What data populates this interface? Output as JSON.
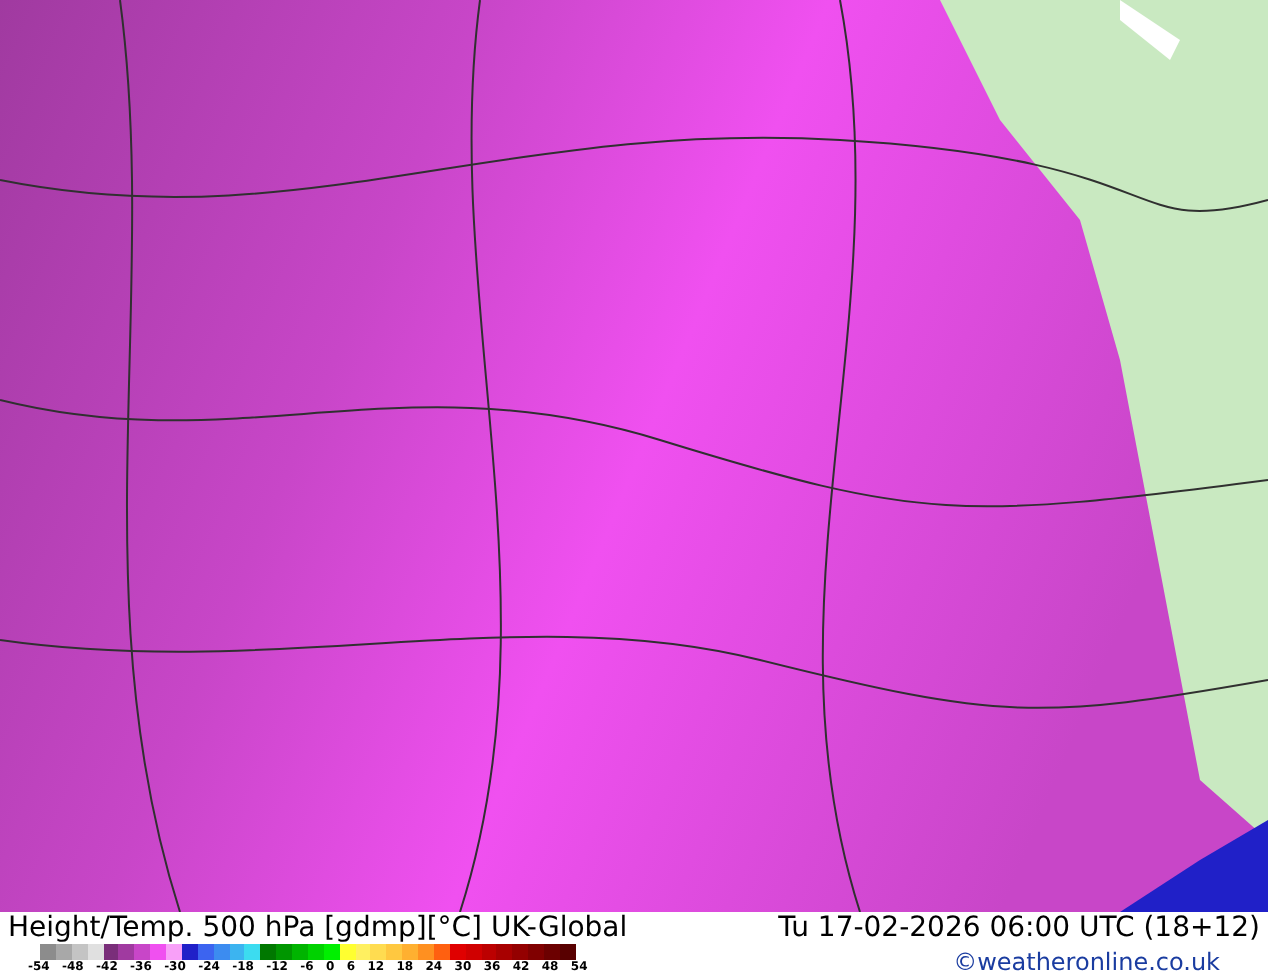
{
  "title": "Height/Temp. 500 hPa [gdmp][°C] UK-Global",
  "datetime": "Tu 17-02-2026 06:00 UTC (18+12)",
  "credit": "©weatheronline.co.uk",
  "legend": {
    "swatches": [
      {
        "color": "#8c8c8c"
      },
      {
        "color": "#a8a8a8"
      },
      {
        "color": "#c4c4c4"
      },
      {
        "color": "#e0e0e0"
      },
      {
        "color": "#7a2e7a"
      },
      {
        "color": "#a03aa0"
      },
      {
        "color": "#c846c8"
      },
      {
        "color": "#f050f0"
      },
      {
        "color": "#f8a0f8"
      },
      {
        "color": "#2020c8"
      },
      {
        "color": "#3c64f0"
      },
      {
        "color": "#3c8cf0"
      },
      {
        "color": "#3cb4f0"
      },
      {
        "color": "#3cdcf0"
      },
      {
        "color": "#007800"
      },
      {
        "color": "#009600"
      },
      {
        "color": "#00b400"
      },
      {
        "color": "#00d200"
      },
      {
        "color": "#00f000"
      },
      {
        "color": "#ffff30"
      },
      {
        "color": "#fff060"
      },
      {
        "color": "#ffdc50"
      },
      {
        "color": "#ffc840"
      },
      {
        "color": "#ffb030"
      },
      {
        "color": "#ff9020"
      },
      {
        "color": "#ff6010"
      },
      {
        "color": "#e00000"
      },
      {
        "color": "#d00000"
      },
      {
        "color": "#bc0000"
      },
      {
        "color": "#a80000"
      },
      {
        "color": "#940000"
      },
      {
        "color": "#800000"
      },
      {
        "color": "#6c0000"
      },
      {
        "color": "#580000"
      }
    ],
    "ticks": [
      "-54",
      "-48",
      "-42",
      "-36",
      "-30",
      "-24",
      "-18",
      "-12",
      "-6",
      "0",
      "6",
      "12",
      "18",
      "24",
      "30",
      "36",
      "42",
      "48",
      "54"
    ]
  }
}
